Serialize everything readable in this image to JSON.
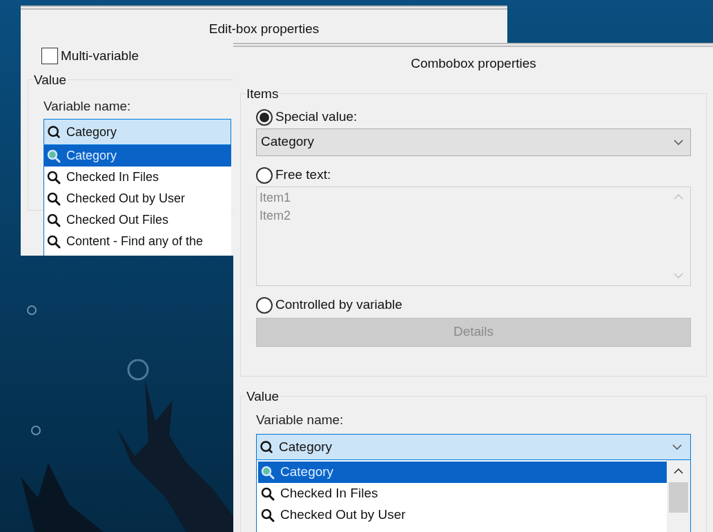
{
  "edit_box_dialog": {
    "title": "Edit-box properties",
    "multi_variable": {
      "label": "Multi-variable",
      "checked": false
    },
    "value_group": {
      "title": "Value",
      "variable_label": "Variable name:",
      "variable_value": "Category",
      "options": [
        {
          "label": "Category",
          "selected": true
        },
        {
          "label": "Checked In Files",
          "selected": false
        },
        {
          "label": "Checked Out by User",
          "selected": false
        },
        {
          "label": "Checked Out Files",
          "selected": false
        },
        {
          "label": "Content - Find any of the",
          "selected": false
        }
      ]
    }
  },
  "combobox_dialog": {
    "title": "Combobox properties",
    "items_group": {
      "title": "Items",
      "options": [
        {
          "kind": "dropdown",
          "label": "Special value:",
          "selected": true,
          "value": "Category"
        },
        {
          "kind": "textarea",
          "label": "Free text:",
          "selected": false,
          "disabled": true,
          "lines": [
            "Item1",
            "Item2"
          ]
        },
        {
          "kind": "button",
          "label": "Controlled by variable",
          "selected": false,
          "disabled": true,
          "button": "Details"
        }
      ]
    },
    "value_group": {
      "title": "Value",
      "variable_label": "Variable name:",
      "variable_value": "Category",
      "options": [
        {
          "label": "Category",
          "selected": true
        },
        {
          "label": "Checked In Files",
          "selected": false
        },
        {
          "label": "Checked Out by User",
          "selected": false
        }
      ]
    }
  }
}
